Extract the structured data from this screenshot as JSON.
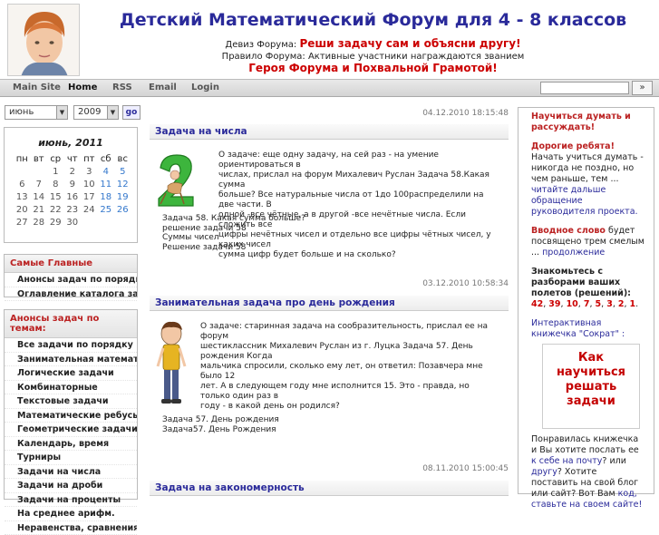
{
  "header": {
    "title": "Детский Математический Форум для 4 - 8 классов",
    "motto_prefix": "Девиз Форума: ",
    "motto_main": "Реши задачу сам и объясни другу!",
    "rule_line": "Правило Форума: Активные участники награждаются званием",
    "hero_line": "Героя Форума и Похвальной Грамотой!"
  },
  "nav": {
    "items": [
      "Main Site",
      "Home",
      "RSS",
      "Email",
      "Login"
    ],
    "search_btn": "»"
  },
  "archive": {
    "month": "июнь",
    "year": "2009",
    "go": "go"
  },
  "calendar": {
    "title": "июнь, 2011",
    "weekdays": [
      "пн",
      "вт",
      "ср",
      "чт",
      "пт",
      "сб",
      "вс"
    ],
    "rows": [
      [
        "",
        "",
        "1",
        "2",
        "3",
        "4",
        "5"
      ],
      [
        "6",
        "7",
        "8",
        "9",
        "10",
        "11",
        "12"
      ],
      [
        "13",
        "14",
        "15",
        "16",
        "17",
        "18",
        "19"
      ],
      [
        "20",
        "21",
        "22",
        "23",
        "24",
        "25",
        "26"
      ],
      [
        "27",
        "28",
        "29",
        "30",
        "",
        "",
        ""
      ]
    ]
  },
  "main_box": {
    "title": "Самые Главные",
    "items": [
      "Анонсы задач по порядку",
      "Оглавление каталога задач"
    ]
  },
  "topics_box": {
    "title": "Анонсы задач по темам:",
    "items": [
      "Все задачи по порядку",
      "Занимательная математика",
      "Логические задачи",
      "Комбинаторные",
      "Текстовые задачи",
      "Математические ребусы",
      "Геометрические задачи",
      "Календарь, время",
      "Турниры",
      "Задачи на числа",
      "Задачи на дроби",
      "Задачи на проценты",
      "На среднее арифм.",
      "Неравенства, сравнения"
    ]
  },
  "posts": [
    {
      "date": "04.12.2010 18:15:48",
      "title": "Задача на числа",
      "body": [
        "О задаче: еще одну задачу, на сей раз - на умение ориентироваться в",
        "числах, прислал на форум Михалевич Руслан Задача 58.Какая сумма",
        "больше? Все натуральные числа от 1до 100распределили на две части. В",
        "одной -все чётные, а в другой -все нечётные числа. Если сложить все",
        "цифры нечётных чисел и отдельно все цифры чётных чисел, у каких чисел",
        "сумма цифр будет больше и на сколько?"
      ],
      "tags": [
        "Задача 58. Какая сумма больше?",
        "решение задачи 58",
        "Суммы чисел",
        "Решение задачи 58"
      ]
    },
    {
      "date": "03.12.2010 10:58:34",
      "title": "Занимательная задача про день рождения",
      "body": [
        "О задаче: старинная задача на сообразительность, прислал ее на форум",
        "шестиклассник Михалевич Руслан из г. Луцка Задача 57. День рождения Когда",
        "мальчика спросили, сколько ему лет, он ответил: Позавчера мне было 12",
        "лет. А в следующем году мне исполнится 15. Это - правда, но только один раз в",
        "году - в какой день он родился?"
      ],
      "tags": [
        "Задача 57. День рождения",
        "Задача57. День Рождения"
      ]
    },
    {
      "date": "08.11.2010 15:00:45",
      "title": "Задача на закономерность"
    }
  ],
  "sidebar": {
    "learn_title": "Научиться думать и рассуждать!",
    "dear_label": "Дорогие ребята!",
    "dear_text": " Начать учиться думать - никогда не поздно, но чем раньше, тем ... ",
    "dear_link": "читайте дальше обращение руководителя проекта.",
    "intro_label": "Вводное слово",
    "intro_text": " будет посвящено трем смелым ... ",
    "intro_link": "продолжение",
    "meet_text": "Знакомьтесь с разборами ваших полетов (решений):",
    "nums": [
      "42",
      "39",
      "10",
      "7",
      "5",
      "3",
      "2",
      "1"
    ],
    "booklet_label": "Интерактивная книжечка \"Сократ\" :",
    "booklet_title": "Как научиться решать задачи",
    "liked_text1": "Понравилась книжечка и Вы хотите послать ее ",
    "liked_link1": "к себе на почту",
    "liked_text2": "? или ",
    "liked_link2": "другу",
    "liked_text3": "? Хотите поставить на свой блог или сайт? Вот Вам ",
    "liked_link3": "код, ставьте на своем сайте!"
  }
}
